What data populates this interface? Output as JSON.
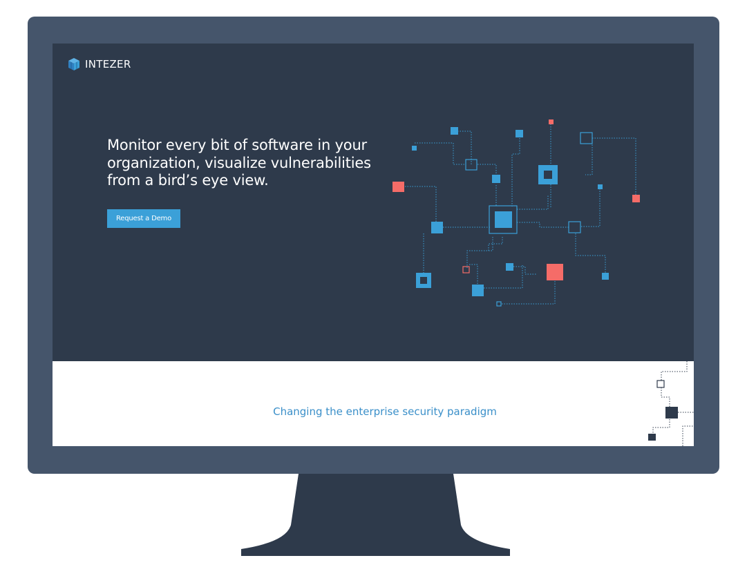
{
  "brand": {
    "name": "INTEZER",
    "logo_icon": "cube-logo-icon"
  },
  "hero": {
    "headline": "Monitor every bit of software in your organization, visualize vulnerabilities from a bird’s eye view.",
    "cta_label": "Request a Demo"
  },
  "lower": {
    "tagline": "Changing the enterprise security paradigm"
  },
  "colors": {
    "monitor_frame": "#45556b",
    "hero_bg": "#2e3a4b",
    "accent_blue": "#3ba0d8",
    "accent_red": "#f56c68",
    "tagline_blue": "#3a8fc9"
  }
}
